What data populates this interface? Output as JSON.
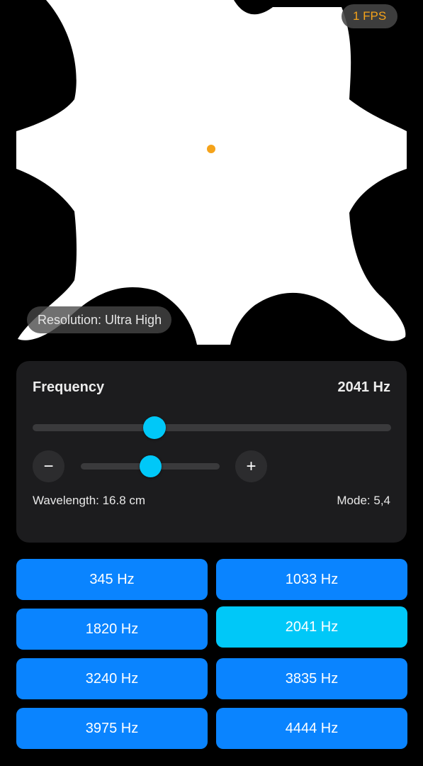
{
  "visualization": {
    "fps_label": "1 FPS",
    "resolution_label": "Resolution: Ultra High",
    "pattern_color": "#ffffff",
    "background_color": "#000000",
    "source_dot_color": "#f5a31a"
  },
  "frequency": {
    "title": "Frequency",
    "value_label": "2041 Hz",
    "slider_fraction": 0.34,
    "fine_slider_fraction": 0.5,
    "minus_label": "−",
    "plus_label": "+",
    "wavelength_label": "Wavelength: 16.8 cm",
    "mode_label": "Mode: 5,4"
  },
  "presets": [
    {
      "label": "345 Hz",
      "active": false
    },
    {
      "label": "1033 Hz",
      "active": false
    },
    {
      "label": "1820 Hz",
      "active": false
    },
    {
      "label": "2041 Hz",
      "active": true
    },
    {
      "label": "3240 Hz",
      "active": false
    },
    {
      "label": "3835 Hz",
      "active": false
    },
    {
      "label": "3975 Hz",
      "active": false
    },
    {
      "label": "4444 Hz",
      "active": false
    }
  ],
  "colors": {
    "accent": "#00c8f8",
    "button_blue": "#0a84ff",
    "panel_bg": "#1c1c1e"
  }
}
